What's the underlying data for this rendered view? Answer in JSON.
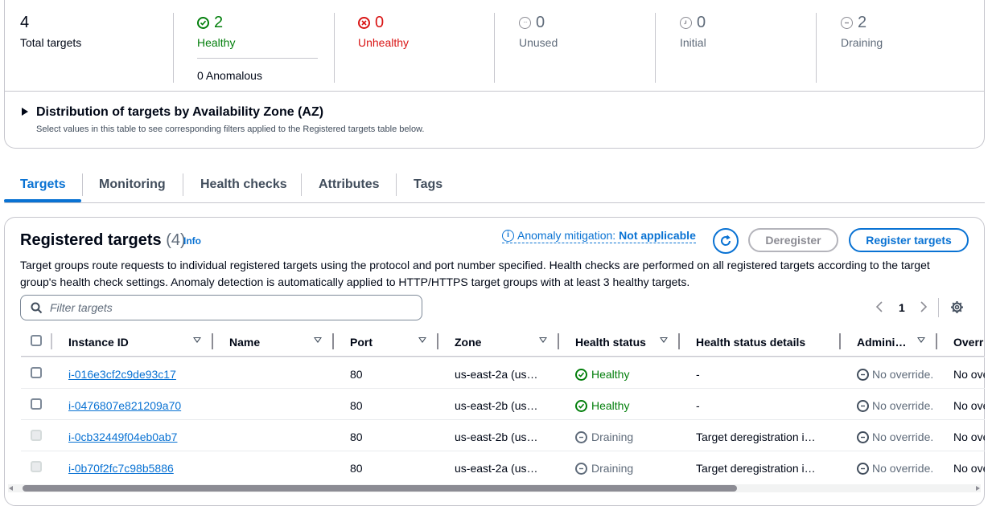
{
  "summary": {
    "total": {
      "value": "4",
      "label": "Total targets"
    },
    "healthy": {
      "value": "2",
      "label": "Healthy",
      "anomalous": "0 Anomalous"
    },
    "unhealthy": {
      "value": "0",
      "label": "Unhealthy"
    },
    "unused": {
      "value": "0",
      "label": "Unused"
    },
    "initial": {
      "value": "0",
      "label": "Initial"
    },
    "draining": {
      "value": "2",
      "label": "Draining"
    },
    "distribution": {
      "title": "Distribution of targets by Availability Zone (AZ)",
      "description": "Select values in this table to see corresponding filters applied to the Registered targets table below."
    }
  },
  "tabs": [
    "Targets",
    "Monitoring",
    "Health checks",
    "Attributes",
    "Tags"
  ],
  "registered": {
    "title": "Registered targets",
    "count": "(4)",
    "info": "Info",
    "anomaly_prefix": "Anomaly mitigation:",
    "anomaly_value": "Not applicable",
    "deregister_label": "Deregister",
    "register_label": "Register targets",
    "description": "Target groups route requests to individual registered targets using the protocol and port number specified. Health checks are performed on all registered targets according to the target group's health check settings. Anomaly detection is automatically applied to HTTP/HTTPS target groups with at least 3 healthy targets.",
    "filter_placeholder": "Filter targets",
    "page": "1"
  },
  "columns": [
    "Instance ID",
    "Name",
    "Port",
    "Zone",
    "Health status",
    "Health status details",
    "Admini…",
    "Overri"
  ],
  "rows": [
    {
      "id": "i-016e3cf2c9de93c17",
      "name": "",
      "port": "80",
      "zone": "us-east-2a (us…",
      "status": "Healthy",
      "details": "-",
      "admin": "No override.",
      "override": "No ove"
    },
    {
      "id": "i-0476807e821209a70",
      "name": "",
      "port": "80",
      "zone": "us-east-2b (us…",
      "status": "Healthy",
      "details": "-",
      "admin": "No override.",
      "override": "No ove"
    },
    {
      "id": "i-0cb32449f04eb0ab7",
      "name": "",
      "port": "80",
      "zone": "us-east-2b (us…",
      "status": "Draining",
      "details": "Target deregistration i…",
      "admin": "No override.",
      "override": "No ove"
    },
    {
      "id": "i-0b70f2fc7c98b5886",
      "name": "",
      "port": "80",
      "zone": "us-east-2a (us…",
      "status": "Draining",
      "details": "Target deregistration i…",
      "admin": "No override.",
      "override": "No ove"
    }
  ],
  "colors": {
    "accent": "#0972d3",
    "healthy": "#037f0c",
    "unhealthy": "#d91515",
    "muted": "#5f6b7a"
  },
  "icons": {
    "healthy": "check-circle-icon",
    "unhealthy": "x-circle-icon",
    "unused": "dots-circle-icon",
    "initial": "clock-icon",
    "draining": "minus-circle-icon",
    "refresh": "refresh-icon",
    "settings": "gear-icon"
  }
}
